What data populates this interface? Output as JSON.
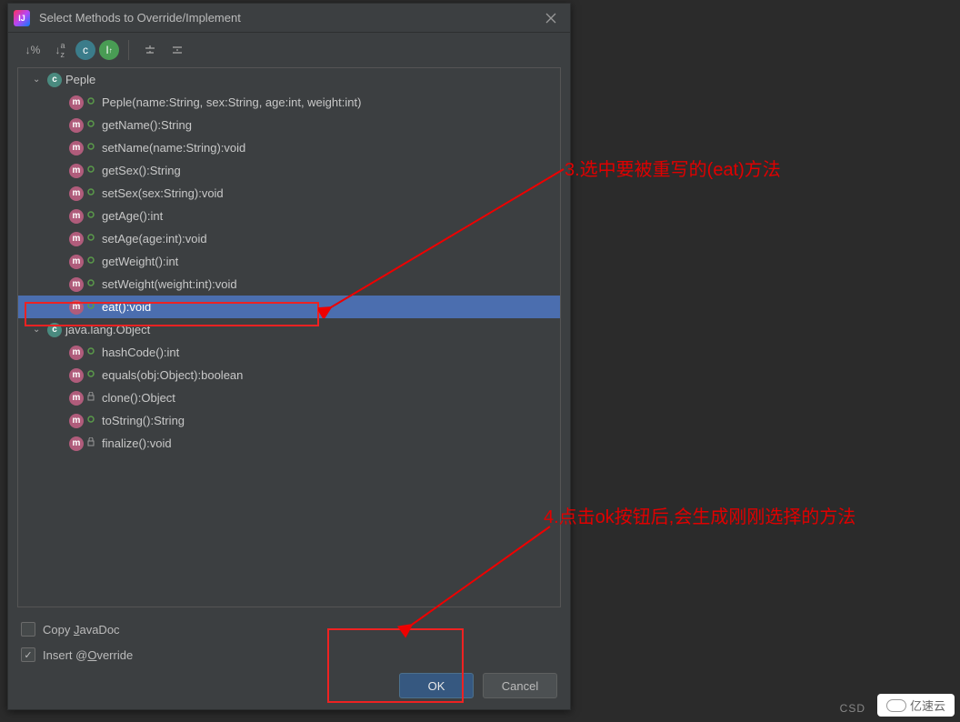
{
  "dialog": {
    "title": "Select Methods to Override/Implement"
  },
  "tree": {
    "classes": [
      {
        "name": "Peple",
        "methods": [
          {
            "sig": "Peple(name:String, sex:String, age:int, weight:int)",
            "vis": "public",
            "selected": false
          },
          {
            "sig": "getName():String",
            "vis": "public",
            "selected": false
          },
          {
            "sig": "setName(name:String):void",
            "vis": "public",
            "selected": false
          },
          {
            "sig": "getSex():String",
            "vis": "public",
            "selected": false
          },
          {
            "sig": "setSex(sex:String):void",
            "vis": "public",
            "selected": false
          },
          {
            "sig": "getAge():int",
            "vis": "public",
            "selected": false
          },
          {
            "sig": "setAge(age:int):void",
            "vis": "public",
            "selected": false
          },
          {
            "sig": "getWeight():int",
            "vis": "public",
            "selected": false
          },
          {
            "sig": "setWeight(weight:int):void",
            "vis": "public",
            "selected": false
          },
          {
            "sig": "eat():void",
            "vis": "public",
            "selected": true
          }
        ]
      },
      {
        "name": "java.lang.Object",
        "methods": [
          {
            "sig": "hashCode():int",
            "vis": "public",
            "selected": false
          },
          {
            "sig": "equals(obj:Object):boolean",
            "vis": "public",
            "selected": false
          },
          {
            "sig": "clone():Object",
            "vis": "protected",
            "selected": false
          },
          {
            "sig": "toString():String",
            "vis": "public",
            "selected": false
          },
          {
            "sig": "finalize():void",
            "vis": "protected",
            "selected": false
          }
        ]
      }
    ]
  },
  "footer": {
    "copy_javadoc": "Copy JavaDoc",
    "insert_override": "Insert @Override",
    "ok": "OK",
    "cancel": "Cancel"
  },
  "annotations": {
    "step3": "3.选中要被重写的(eat)方法",
    "step4": "4.点击ok按钮后,会生成刚刚选择的方法"
  },
  "watermark": {
    "csd": "CSD",
    "brand": "亿速云"
  }
}
